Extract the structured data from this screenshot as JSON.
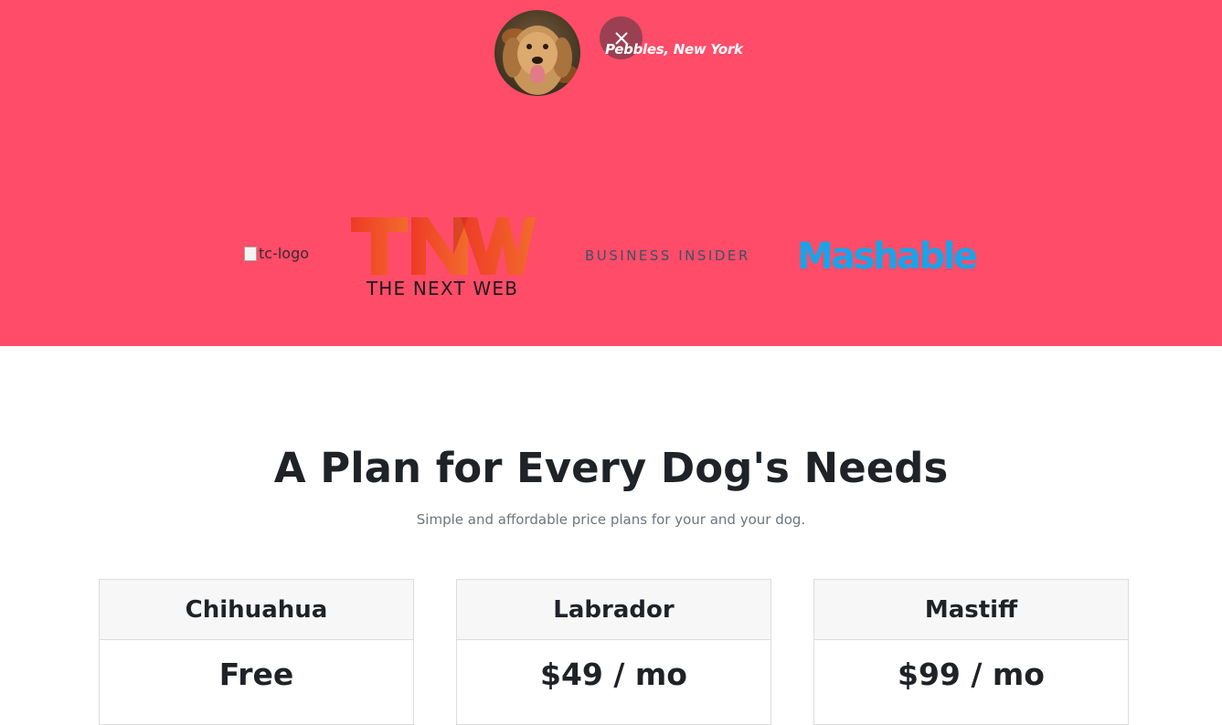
{
  "hero": {
    "background": "#ff4c68",
    "testimonial": {
      "avatar_alt": "dog-img",
      "location": "Pebbles, New York"
    },
    "press_logos": {
      "techcrunch_alt": "tc-logo",
      "tnw_mark": "TNW",
      "tnw_caption": "THE NEXT WEB",
      "business_insider": "BUSINESS INSIDER",
      "mashable": "Mashable"
    }
  },
  "pricing": {
    "title": "A Plan for Every Dog's Needs",
    "subtitle": "Simple and affordable price plans for your and your dog.",
    "plans": [
      {
        "name": "Chihuahua",
        "price": "Free"
      },
      {
        "name": "Labrador",
        "price": "$49 / mo"
      },
      {
        "name": "Mastiff",
        "price": "$99 / mo"
      }
    ]
  },
  "colors": {
    "accent": "#ff4c68",
    "mashable_blue": "#1aa3e8",
    "tnw_orange": "#f0502a",
    "business_insider": "#3e5168"
  },
  "icons": {
    "close": "close-icon",
    "broken_image": "broken-image-icon"
  }
}
